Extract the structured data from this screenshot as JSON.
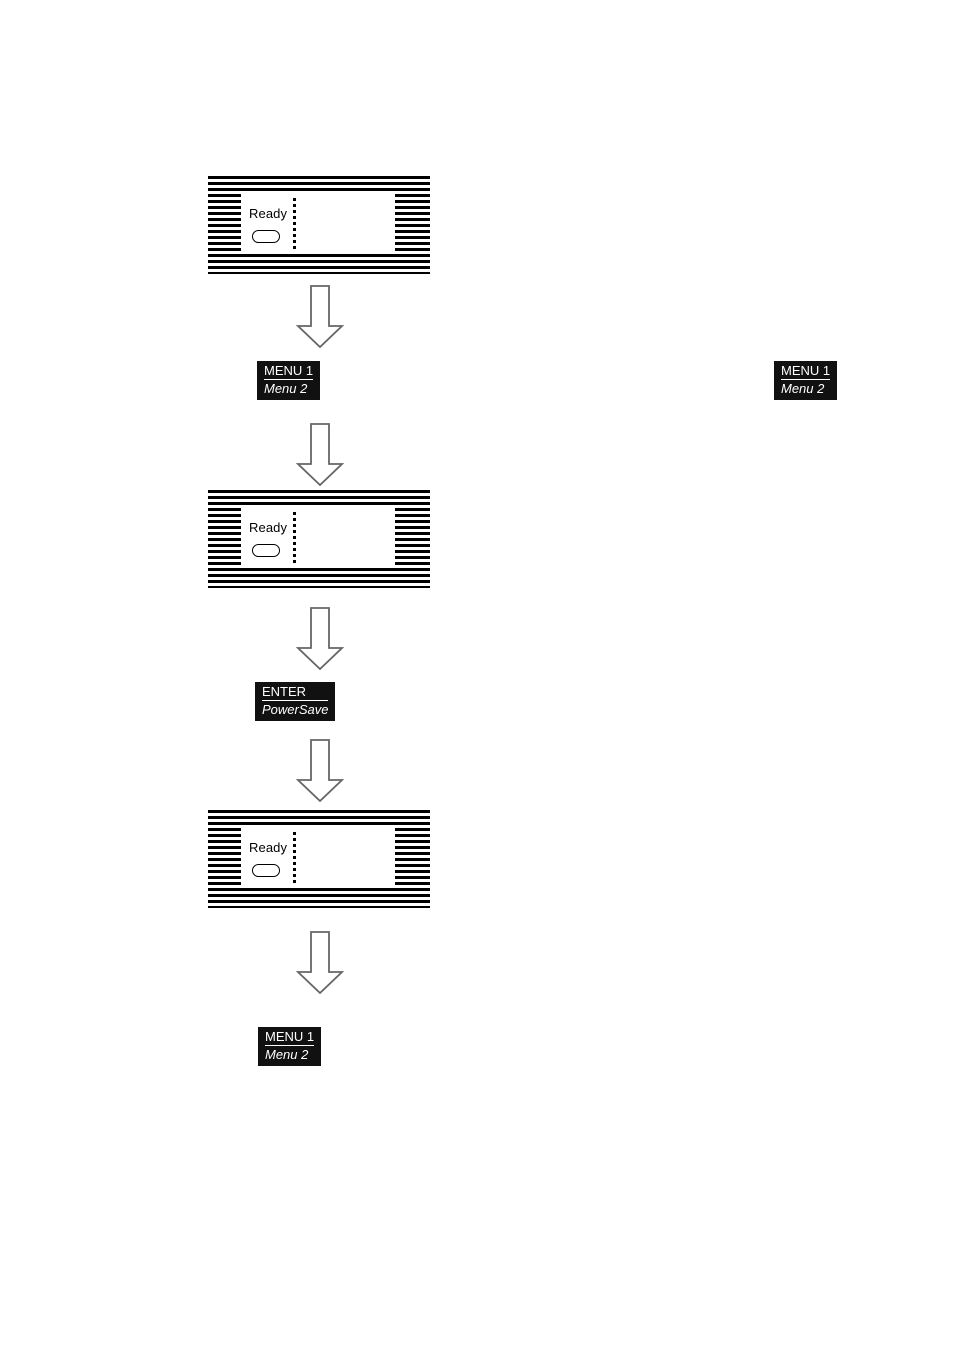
{
  "diagram": {
    "title": "Printer control panel PowerSave menu sequence",
    "background_color": "#ffffff",
    "chip_background_color": "#111111",
    "chip_text_color": "#ffffff",
    "arrow_stroke_color": "#666666",
    "panels": [
      {
        "id": "panel-1",
        "ready_label": "Ready",
        "led_name": "ready-led-indicator",
        "display_text": ""
      },
      {
        "id": "panel-2",
        "ready_label": "Ready",
        "led_name": "ready-led-indicator",
        "display_text": ""
      },
      {
        "id": "panel-3",
        "ready_label": "Ready",
        "led_name": "ready-led-indicator",
        "display_text": ""
      }
    ],
    "chips": [
      {
        "id": "chip-menu-1",
        "line1": "MENU 1",
        "line2": "Menu 2"
      },
      {
        "id": "chip-menu-1-margin",
        "line1": "MENU 1",
        "line2": "Menu 2"
      },
      {
        "id": "chip-enter",
        "line1": "ENTER",
        "line2": "PowerSave"
      },
      {
        "id": "chip-menu-1-bottom",
        "line1": "MENU 1",
        "line2": "Menu 2"
      }
    ],
    "arrows": [
      {
        "id": "arrow-1",
        "direction": "down"
      },
      {
        "id": "arrow-2",
        "direction": "down"
      },
      {
        "id": "arrow-3",
        "direction": "down"
      },
      {
        "id": "arrow-4",
        "direction": "down"
      }
    ]
  }
}
